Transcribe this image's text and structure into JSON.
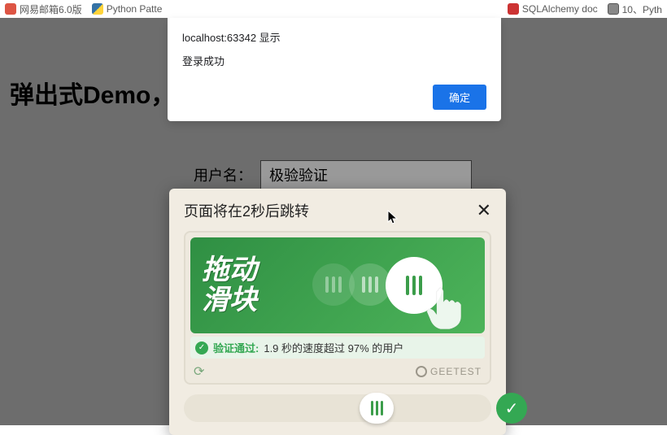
{
  "bookmarks": {
    "left": [
      {
        "label": "网易邮箱6.0版",
        "icon": "mail"
      },
      {
        "label": "Python Patte",
        "icon": "py"
      }
    ],
    "right": [
      {
        "label": "SQLAlchemy doc",
        "icon": "sql"
      },
      {
        "label": "10、Pyth",
        "icon": "generic"
      }
    ]
  },
  "alert": {
    "origin": "localhost:63342 显示",
    "message": "登录成功",
    "ok_label": "确定"
  },
  "heading": "弹出式Demo，                                              的验证结果值",
  "form": {
    "username_label": "用户名：",
    "username_value": "极验验证"
  },
  "captcha": {
    "title": "页面将在2秒后跳转",
    "drag_text_line1": "拖动",
    "drag_text_line2": "滑块",
    "status_label": "验证通过:",
    "status_detail": "1.9 秒的速度超过 97% 的用户",
    "brand": "GEETEST"
  }
}
